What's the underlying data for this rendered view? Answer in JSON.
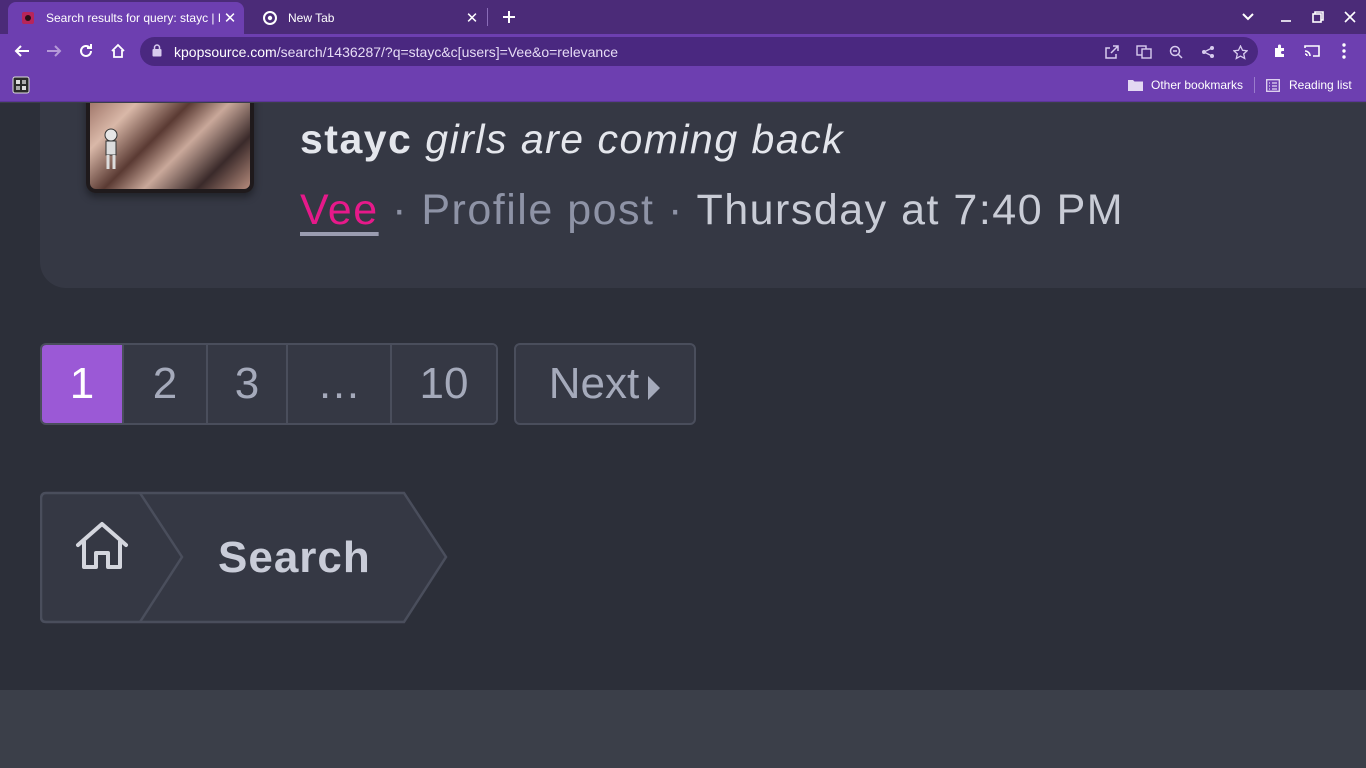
{
  "browser": {
    "tabs": [
      {
        "title": "Search results for query: stayc | K",
        "active": true
      },
      {
        "title": "New Tab",
        "active": false
      }
    ],
    "url": {
      "host": "kpopsource.com",
      "path": "/search/1436287/?q=stayc&c[users]=Vee&o=relevance"
    },
    "bookmarks": {
      "other_label": "Other bookmarks",
      "reading_label": "Reading list"
    },
    "colors": {
      "tabstrip": "#4b2b78",
      "toolbar": "#6d3fb0"
    }
  },
  "result": {
    "title_bold": "stayc",
    "title_rest": "girls are coming back",
    "author": "Vee",
    "separator": "·",
    "type": "Profile post",
    "time": "Thursday at 7:40 PM"
  },
  "pagination": {
    "pages": [
      "1",
      "2",
      "3",
      "…",
      "10"
    ],
    "current": "1",
    "next_label": "Next"
  },
  "breadcrumb": {
    "home_icon": "home-icon",
    "label": "Search"
  },
  "colors": {
    "accent": "#9b59d6",
    "author_link": "#e6198a",
    "page_bg": "#2c2f39"
  }
}
